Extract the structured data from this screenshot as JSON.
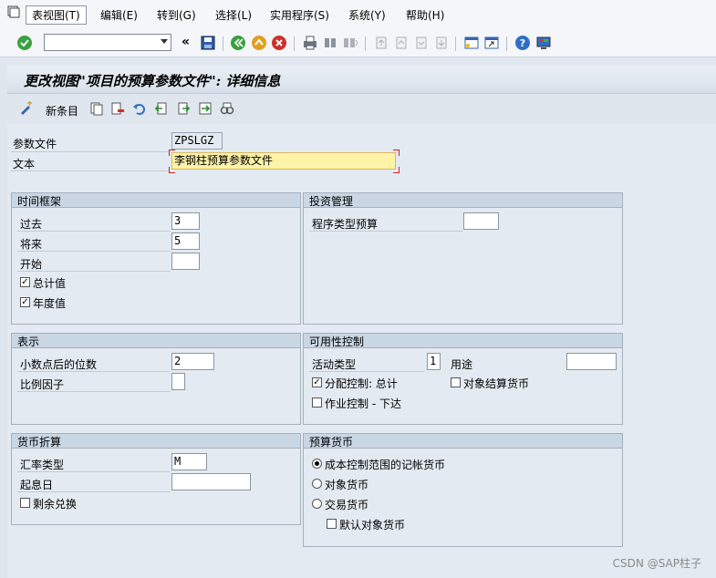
{
  "menu": {
    "items": [
      {
        "label": "表视图(T)"
      },
      {
        "label": "编辑(E)"
      },
      {
        "label": "转到(G)"
      },
      {
        "label": "选择(L)"
      },
      {
        "label": "实用程序(S)"
      },
      {
        "label": "系统(Y)"
      },
      {
        "label": "帮助(H)"
      }
    ]
  },
  "toolbar": {
    "command_value": "",
    "icons": [
      "enter-icon",
      "back-icon",
      "save-icon",
      "exit-icon",
      "cancel-icon",
      "print-icon",
      "find-icon",
      "find-next-icon",
      "first-page-icon",
      "previous-page-icon",
      "next-page-icon",
      "last-page-icon",
      "new-session-icon",
      "shortcut-icon",
      "help-icon",
      "layout-icon"
    ],
    "colors": {
      "save": "#2a5db0",
      "back": "#3aa040",
      "exit": "#e0a020",
      "cancel": "#d0302a",
      "help": "#2f6fc4"
    }
  },
  "page": {
    "title": "更改视图\"项目的预算参数文件\": 详细信息"
  },
  "app_toolbar": {
    "new_entries_label": "新条目"
  },
  "header_fields": {
    "profile_label": "参数文件",
    "profile_value": "ZPSLGZ",
    "text_label": "文本",
    "text_value": "李钢柱预算参数文件"
  },
  "time_frame": {
    "title": "时间框架",
    "past_label": "过去",
    "past_value": "3",
    "future_label": "将来",
    "future_value": "5",
    "start_label": "开始",
    "start_value": "",
    "total_label": "总计值",
    "total_checked": true,
    "annual_label": "年度值",
    "annual_checked": true
  },
  "investment": {
    "title": "投资管理",
    "program_type_label": "程序类型预算",
    "program_type_value": ""
  },
  "representation": {
    "title": "表示",
    "decimals_label": "小数点后的位数",
    "decimals_value": "2",
    "scaling_label": "比例因子",
    "scaling_value": ""
  },
  "availability": {
    "title": "可用性控制",
    "activity_type_label": "活动类型",
    "activity_type_value": "1",
    "usage_label": "用途",
    "usage_value": "",
    "overall_label": "分配控制: 总计",
    "overall_checked": true,
    "object_currency_label": "对象结算货币",
    "object_currency_checked": false,
    "releases_label": "作业控制 - 下达",
    "releases_checked": false
  },
  "currency_translation": {
    "title": "货币折算",
    "exchange_type_label": "汇率类型",
    "exchange_type_value": "M",
    "value_date_label": "起息日",
    "value_date_value": "",
    "remainder_label": "剩余兑换",
    "remainder_checked": false
  },
  "budget_currency": {
    "title": "预算货币",
    "options": [
      {
        "label": "成本控制范围的记帐货币",
        "selected": true
      },
      {
        "label": "对象货币",
        "selected": false
      },
      {
        "label": "交易货币",
        "selected": false
      }
    ],
    "default_object_label": "默认对象货币",
    "default_object_checked": false
  },
  "watermark": "CSDN @SAP柱子"
}
